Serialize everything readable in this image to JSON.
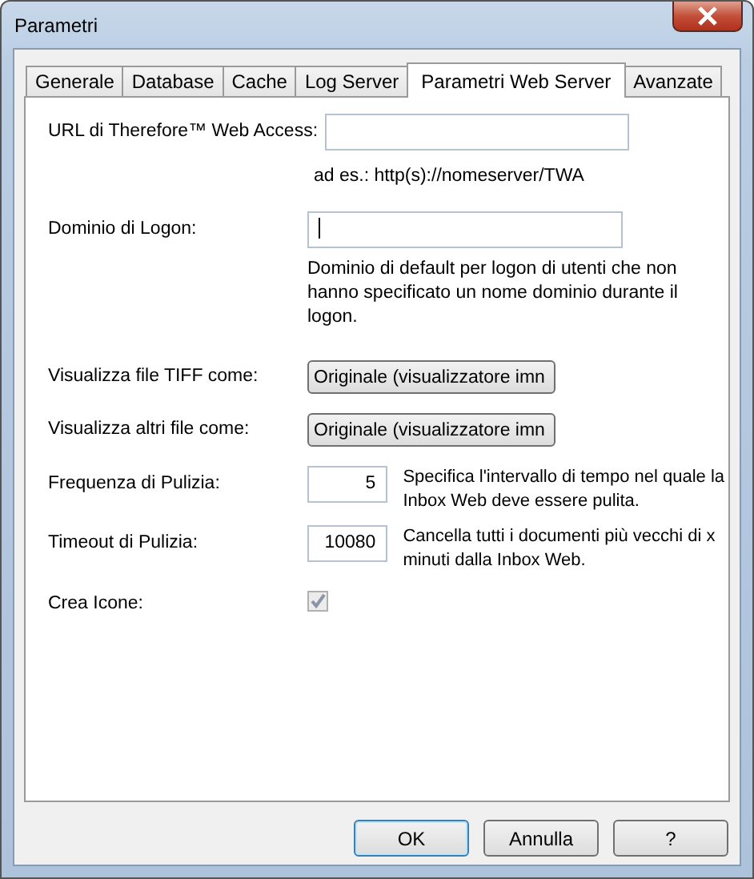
{
  "window": {
    "title": "Parametri"
  },
  "tabs": [
    {
      "label": "Generale",
      "selected": false
    },
    {
      "label": "Database",
      "selected": false
    },
    {
      "label": "Cache",
      "selected": false
    },
    {
      "label": "Log Server",
      "selected": false
    },
    {
      "label": "Parametri Web Server",
      "selected": true
    },
    {
      "label": "Avanzate",
      "selected": false
    }
  ],
  "fields": [
    {
      "kind": "text",
      "label": "URL di Therefore™ Web Access:",
      "note": "ad es.: http(s)://nomeserver/TWA"
    },
    {
      "kind": "text",
      "label": "Dominio di Logon:",
      "focused": true,
      "note": "Dominio di default per logon di utenti che non hanno specificato un nome dominio durante il logon."
    },
    {
      "kind": "select",
      "label": "Visualizza file TIFF come:",
      "value": "Originale (visualizzatore imn"
    },
    {
      "kind": "select",
      "label": "Visualizza altri file come:",
      "value": "Originale (visualizzatore imn"
    },
    {
      "kind": "number",
      "label": "Frequenza di Pulizia:",
      "value": "5",
      "note": "Specifica l'intervallo di tempo nel quale la Inbox Web deve essere pulita."
    },
    {
      "kind": "number",
      "label": "Timeout di Pulizia:",
      "value": "10080",
      "note": "Cancella tutti i documenti più vecchi di x minuti dalla Inbox Web."
    },
    {
      "kind": "checkbox",
      "label": "Crea Icone:",
      "checked": true,
      "disabled": true
    }
  ],
  "buttons": [
    {
      "label": "OK",
      "default": true
    },
    {
      "label": "Annulla",
      "default": false
    },
    {
      "label": "?",
      "default": false
    }
  ]
}
